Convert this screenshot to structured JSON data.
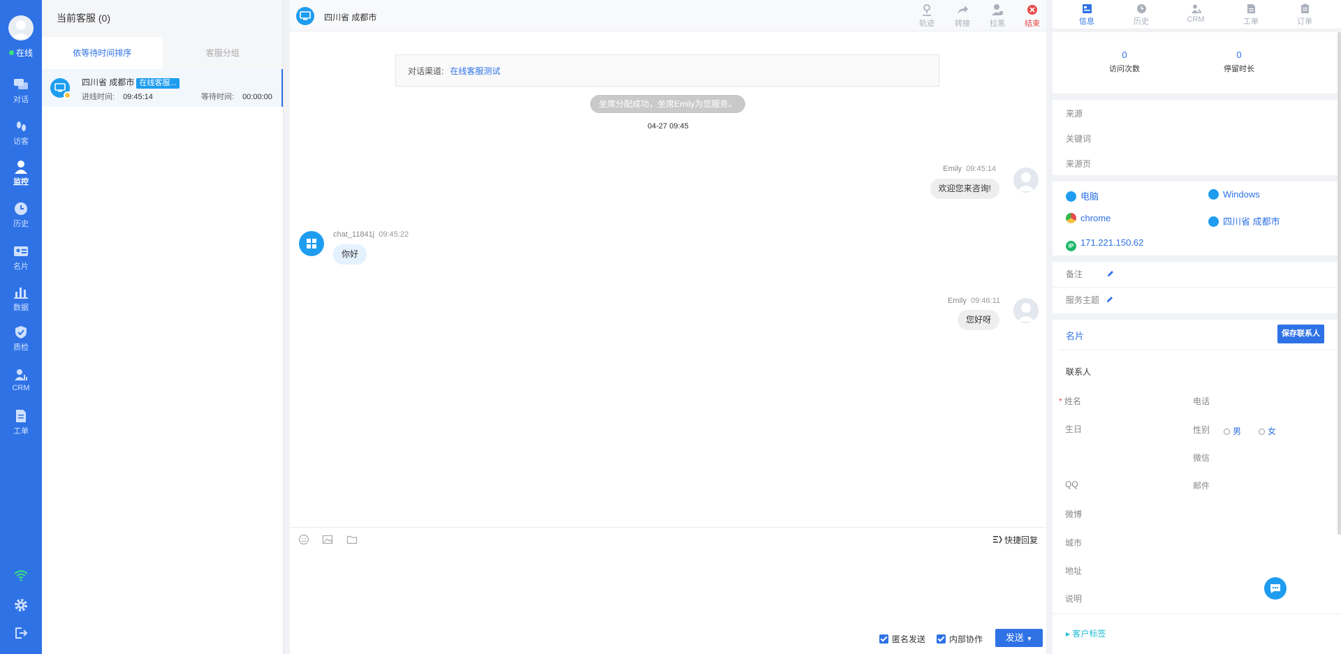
{
  "nav": {
    "status": "在线",
    "items": [
      "对话",
      "访客",
      "监控",
      "历史",
      "名片",
      "数据",
      "质检",
      "CRM",
      "工单"
    ]
  },
  "queue": {
    "title": "当前客服 (0)",
    "tabs": [
      "依等待时间排序",
      "客服分组"
    ],
    "item": {
      "title": "四川省 成都市",
      "badge": "在线客服...",
      "enter_label": "进线时间:",
      "enter_time": "09:45:14",
      "wait_label": "等待时间:",
      "wait_time": "00:00:00"
    }
  },
  "chat": {
    "location": "四川省 成都市",
    "tools": [
      "轨迹",
      "转接",
      "拉黑",
      "结束"
    ],
    "channel_label": "对话渠道:",
    "channel_value": "在线客服测试",
    "system_message": "坐席分配成功，坐席Emily为您服务。",
    "date": "04-27 09:45",
    "messages": [
      {
        "sender": "Emily",
        "time": "09:45:14",
        "text": "欢迎您来咨询!"
      },
      {
        "sender": "chat_11841j",
        "time": "09:45:22",
        "text": "你好"
      },
      {
        "sender": "Emily",
        "time": "09:46:11",
        "text": "您好呀"
      }
    ],
    "quick_reply": "快捷回复",
    "anonymous": "匿名发送",
    "internal": "内部协作",
    "send": "发送"
  },
  "right": {
    "tabs": [
      "信息",
      "历史",
      "CRM",
      "工单",
      "订单"
    ],
    "visits_value": "0",
    "visits_label": "访问次数",
    "stay_value": "0",
    "stay_label": "停留时长",
    "source": "来源",
    "keyword": "关键词",
    "source_page": "来源页",
    "device": "电脑",
    "os": "Windows",
    "browser": "chrome",
    "region": "四川省 成都市",
    "ip_badge": "IP",
    "ip": "171.221.150.62",
    "remark": "备注",
    "service_topic": "服务主题",
    "card_title": "名片",
    "save_contact": "保存联系人",
    "contact_section": "联系人",
    "required_mark": "*",
    "name": "姓名",
    "phone": "电话",
    "birthday": "生日",
    "gender": "性别",
    "male": "男",
    "female": "女",
    "wechat": "微信",
    "qq": "QQ",
    "email": "邮件",
    "weibo": "微博",
    "city": "城市",
    "address": "地址",
    "note": "说明",
    "customer_tag": "客户标签"
  },
  "colors": {
    "brand": "#2e72e6",
    "online": "#3be07b",
    "end": "#e94b4b"
  }
}
